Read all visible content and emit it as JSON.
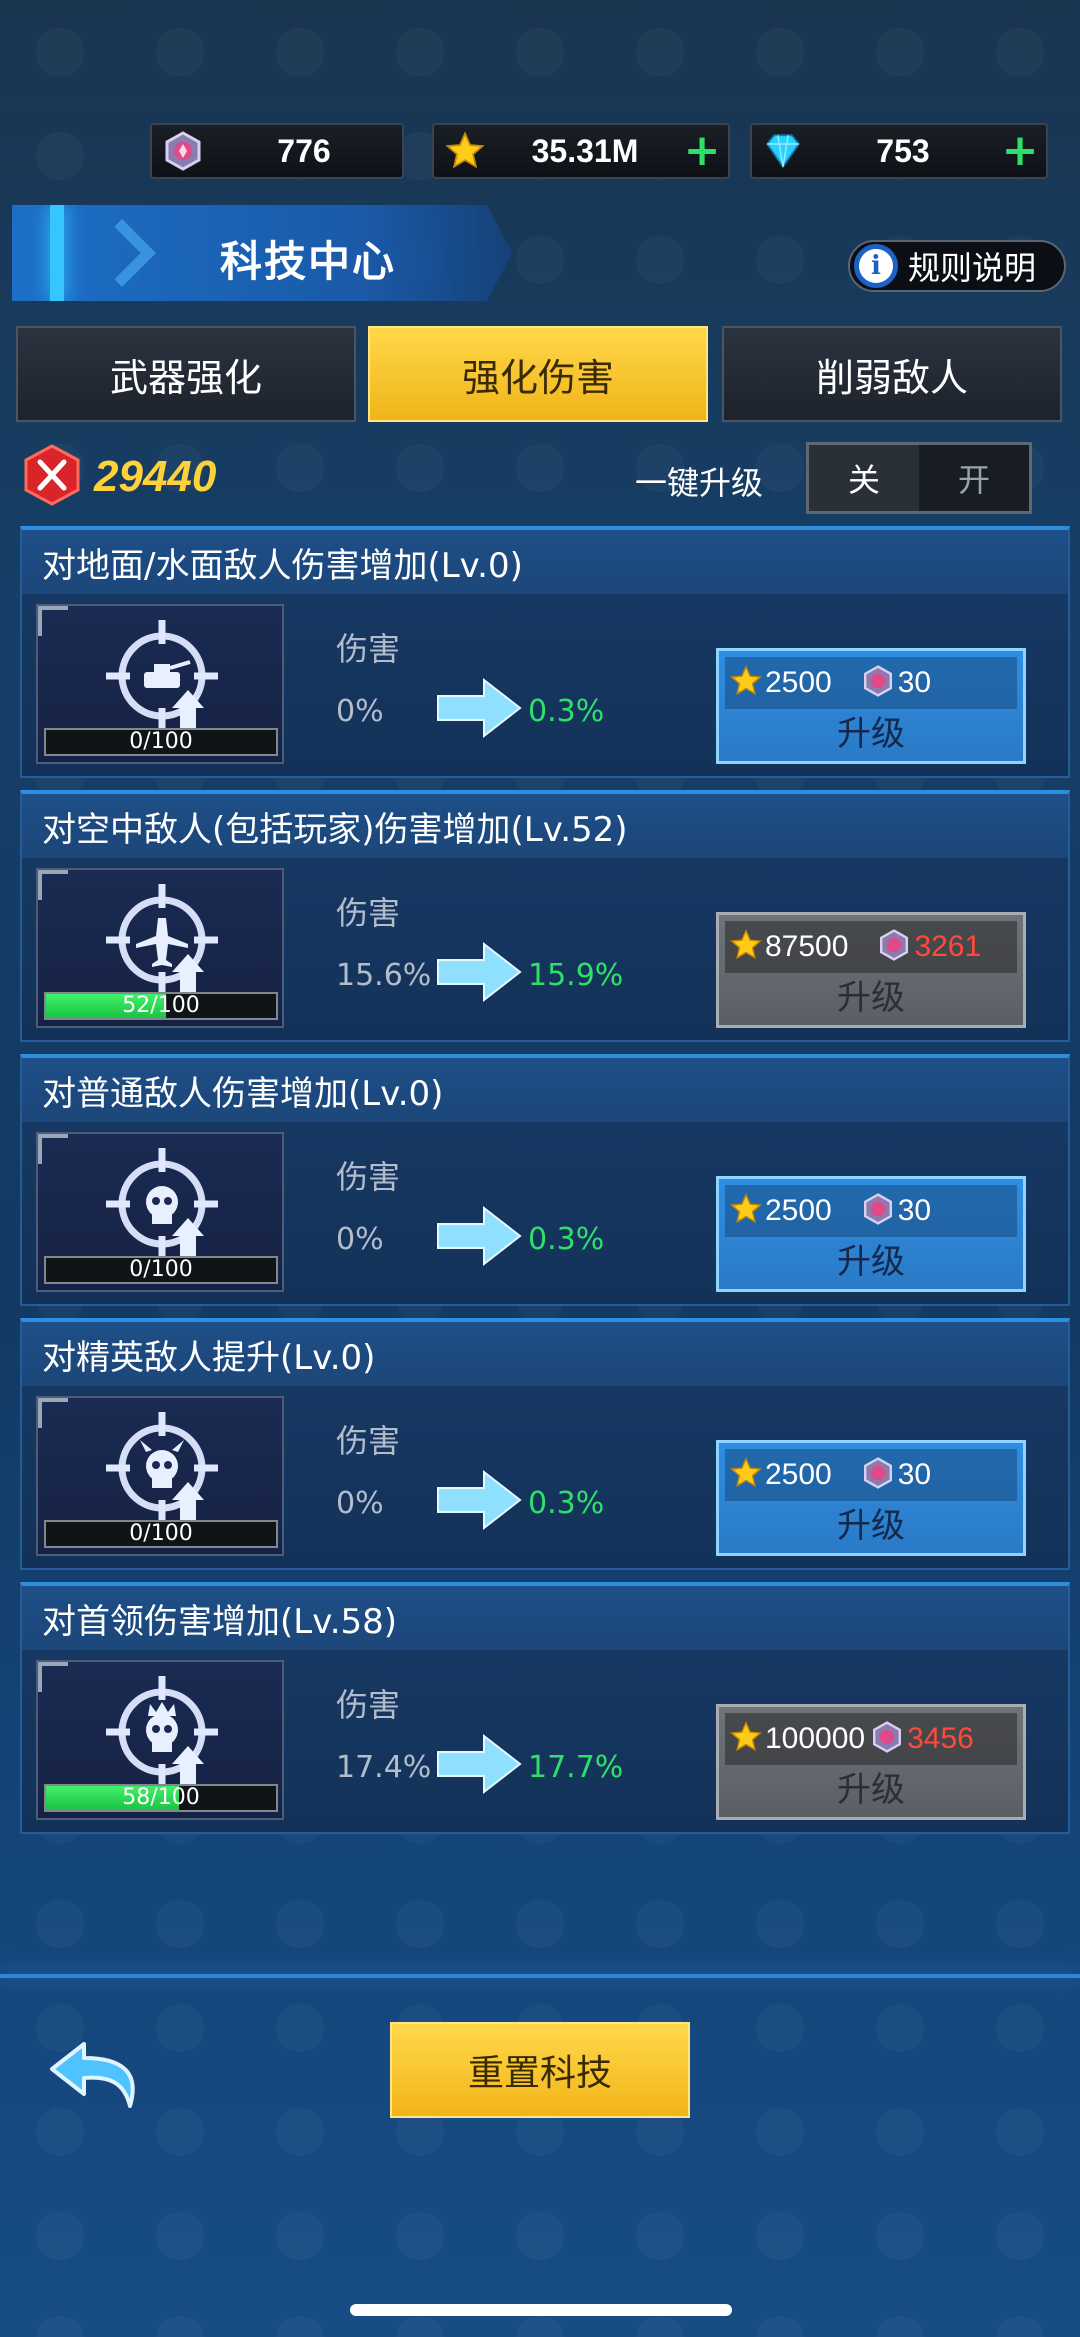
{
  "currencies": [
    {
      "icon": "medal-gem-icon",
      "value": "776",
      "has_plus": false
    },
    {
      "icon": "star-icon",
      "value": "35.31M",
      "has_plus": true
    },
    {
      "icon": "diamond-icon",
      "value": "753",
      "has_plus": true
    }
  ],
  "header": {
    "title": "科技中心",
    "rules_label": "规则说明",
    "rules_icon_glyph": "i"
  },
  "tabs": [
    {
      "label": "武器强化",
      "active": false
    },
    {
      "label": "强化伤害",
      "active": true
    },
    {
      "label": "削弱敌人",
      "active": false
    }
  ],
  "power": {
    "value": "29440"
  },
  "one_key": {
    "label": "一键升级",
    "off_label": "关",
    "on_label": "开",
    "state": "off"
  },
  "cards": [
    {
      "title": "对地面/水面敌人伤害增加(Lv.0)",
      "icon": "tank-target-icon",
      "progress_text": "0/100",
      "progress": 0,
      "stat_label": "伤害",
      "from": "0%",
      "to": "0.3%",
      "star_cost": "2500",
      "gem_cost": "30",
      "gem_insufficient": false,
      "button": "升级",
      "enabled": true
    },
    {
      "title": "对空中敌人(包括玩家)伤害增加(Lv.52)",
      "icon": "aircraft-target-icon",
      "progress_text": "52/100",
      "progress": 0.52,
      "stat_label": "伤害",
      "from": "15.6%",
      "to": "15.9%",
      "star_cost": "87500",
      "gem_cost": "3261",
      "gem_insufficient": true,
      "button": "升级",
      "enabled": false
    },
    {
      "title": "对普通敌人伤害增加(Lv.0)",
      "icon": "skull-target-icon",
      "progress_text": "0/100",
      "progress": 0,
      "stat_label": "伤害",
      "from": "0%",
      "to": "0.3%",
      "star_cost": "2500",
      "gem_cost": "30",
      "gem_insufficient": false,
      "button": "升级",
      "enabled": true
    },
    {
      "title": "对精英敌人提升(Lv.0)",
      "icon": "horned-skull-target-icon",
      "progress_text": "0/100",
      "progress": 0,
      "stat_label": "伤害",
      "from": "0%",
      "to": "0.3%",
      "star_cost": "2500",
      "gem_cost": "30",
      "gem_insufficient": false,
      "button": "升级",
      "enabled": true
    },
    {
      "title": "对首领伤害增加(Lv.58)",
      "icon": "crowned-skull-target-icon",
      "progress_text": "58/100",
      "progress": 0.58,
      "stat_label": "伤害",
      "from": "17.4%",
      "to": "17.7%",
      "star_cost": "100000",
      "gem_cost": "3456",
      "gem_insufficient": true,
      "button": "升级",
      "enabled": false
    }
  ],
  "footer": {
    "reset_label": "重置科技",
    "back_icon": "back-arrow-icon"
  },
  "colors": {
    "accent_yellow": "#f2b51a",
    "green": "#2ee06a",
    "red": "#ff4a3a",
    "blue": "#2f8ee0"
  }
}
